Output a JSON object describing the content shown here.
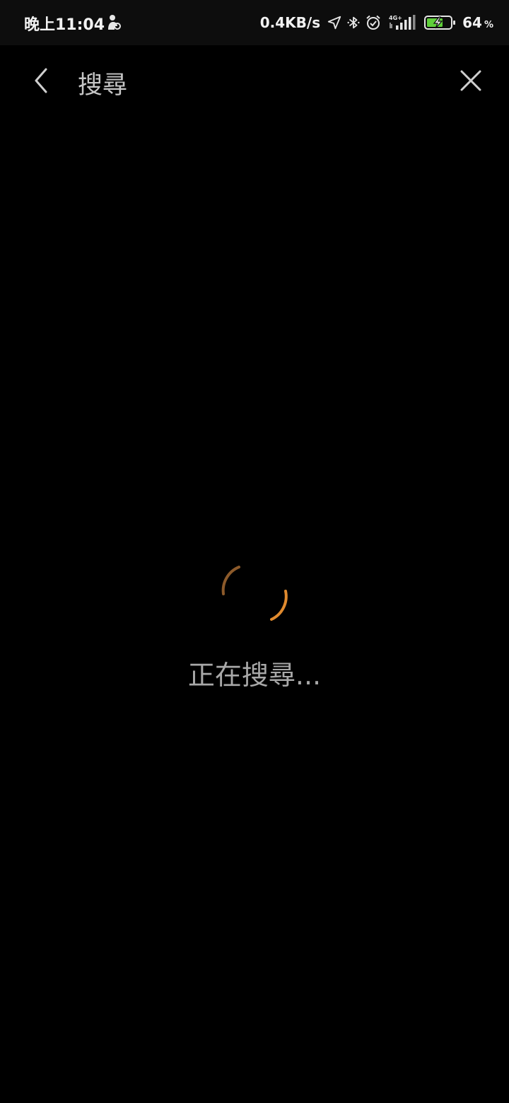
{
  "status_bar": {
    "time": "晚上11:04",
    "network_speed": "0.4KB/s",
    "network_type": "4G+",
    "battery_level": "64",
    "battery_unit": "%",
    "icons": [
      "person-notification-icon",
      "location-icon",
      "bluetooth-icon",
      "alarm-icon",
      "signal-icon",
      "battery-charging-icon"
    ]
  },
  "header": {
    "title": "搜尋",
    "back_icon": "chevron-left-icon",
    "close_icon": "close-icon"
  },
  "loading": {
    "text": "正在搜尋...",
    "spinner_color": "#e08a2e",
    "spinner_color_faded": "#8c5a2a"
  },
  "colors": {
    "background": "#000000",
    "status_bar_background": "#0d0d0d",
    "battery_fill": "#5fcf3a"
  }
}
